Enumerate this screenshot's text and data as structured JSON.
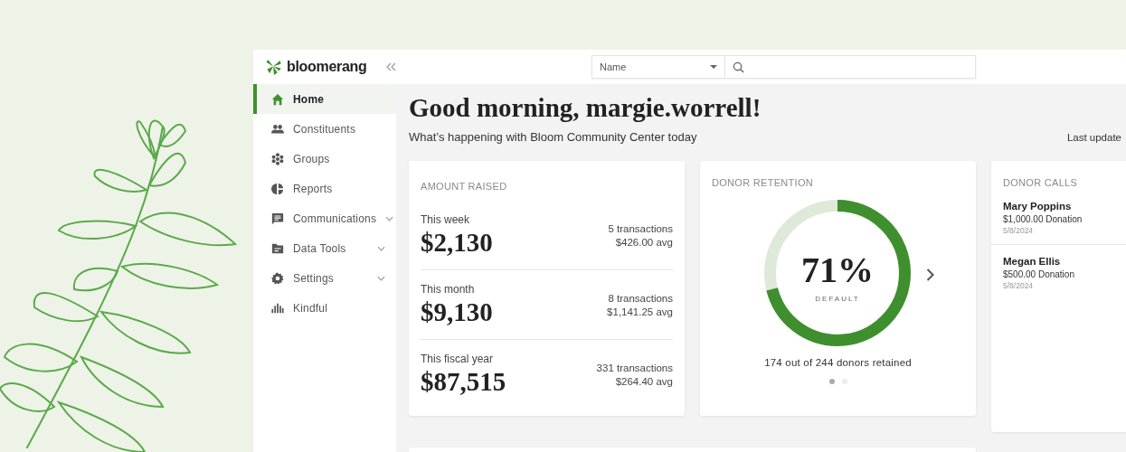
{
  "app": {
    "logo": "bloomerang"
  },
  "search": {
    "search_by": "Name"
  },
  "sidebar": {
    "items": [
      {
        "label": "Home",
        "selected": true,
        "expandable": false
      },
      {
        "label": "Constituents",
        "selected": false,
        "expandable": false
      },
      {
        "label": "Groups",
        "selected": false,
        "expandable": false
      },
      {
        "label": "Reports",
        "selected": false,
        "expandable": false
      },
      {
        "label": "Communications",
        "selected": false,
        "expandable": true
      },
      {
        "label": "Data Tools",
        "selected": false,
        "expandable": true
      },
      {
        "label": "Settings",
        "selected": false,
        "expandable": true
      },
      {
        "label": "Kindful",
        "selected": false,
        "expandable": false
      }
    ]
  },
  "greeting": {
    "title": "Good morning, margie.worrell!",
    "subtitle": "What’s happening with Bloom Community Center today",
    "last_updated": "Last update"
  },
  "amount_raised": {
    "title": "AMOUNT RAISED",
    "periods": [
      {
        "label": "This week",
        "amount": "$2,130",
        "transactions": "5 transactions",
        "average": "$426.00 avg"
      },
      {
        "label": "This month",
        "amount": "$9,130",
        "transactions": "8 transactions",
        "average": "$1,141.25 avg"
      },
      {
        "label": "This fiscal year",
        "amount": "$87,515",
        "transactions": "331 transactions",
        "average": "$264.40 avg"
      }
    ]
  },
  "donor_retention": {
    "title": "DONOR RETENTION",
    "percent": "71%",
    "caption": "DEFAULT",
    "level": 0.71,
    "summary": "174 out of 244 donors retained",
    "pages": [
      {
        "selected": true
      },
      {
        "selected": false
      }
    ]
  },
  "donor_calls": {
    "title": "DONOR CALLS",
    "calls": [
      {
        "name": "Mary Poppins",
        "donation": "$1,000.00 Donation",
        "date": "5/8/2024"
      },
      {
        "name": "Megan Ellis",
        "donation": "$500.00 Donation",
        "date": "5/8/2024"
      }
    ]
  }
}
